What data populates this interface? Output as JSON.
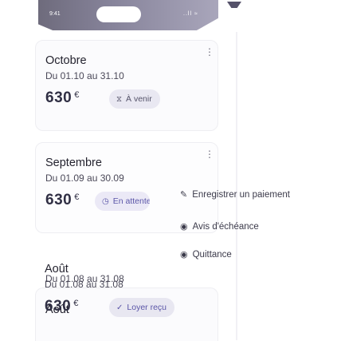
{
  "status_bar": {
    "time": "9:41",
    "signal": "..ll ≈"
  },
  "colors": {
    "upcoming_bg": "#e9e8f2",
    "late_bg": "#ebe9f6",
    "received_bg": "#e8e7f1",
    "accent": "#5b56a8"
  },
  "rents": [
    {
      "month": "Octobre",
      "dates": "Du 01.10 au 31.10",
      "amount": "630",
      "currency": "€",
      "status": {
        "icon": "hourglass-icon",
        "glyph": "⧖",
        "label": "À venir"
      }
    },
    {
      "month": "Septembre",
      "dates": "Du 01.09 au 30.09",
      "amount": "630",
      "currency": "€",
      "status": {
        "icon": "clock-icon",
        "glyph": "◷",
        "label": "En attente"
      }
    },
    {
      "month": "Août",
      "dates": "Du 01.08 au 31.08",
      "amount": "630",
      "currency": "€",
      "status": {
        "icon": "check-icon",
        "glyph": "✓",
        "label": "Loyer reçu"
      }
    }
  ],
  "context_menu": [
    {
      "icon": "edit-icon",
      "glyph": "✎",
      "label": "Enregistrer un paiement"
    },
    {
      "icon": "eye-icon",
      "glyph": "◉",
      "label": "Avis d'échéance"
    },
    {
      "icon": "eye-icon",
      "glyph": "◉",
      "label": "Quittance"
    }
  ]
}
